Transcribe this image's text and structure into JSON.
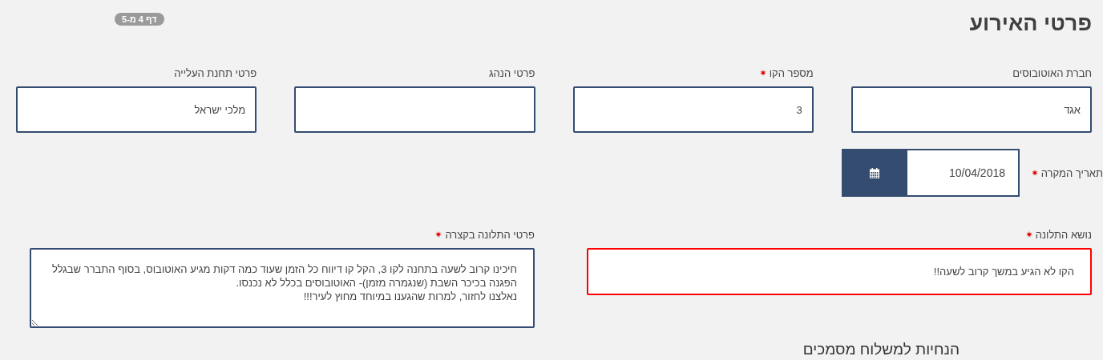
{
  "page_badge": "דף 4 מ-5",
  "title": "פרטי האירוע",
  "fields": [
    {
      "label": "חברת האוטובוסים",
      "value": "אגד",
      "required": false
    },
    {
      "label": "מספר הקו",
      "value": "3",
      "required": true
    },
    {
      "label": "פרטי הנהג",
      "required": false
    },
    {
      "label": "פרטי תחנת העלייה",
      "value": "מלכי ישראל",
      "required": false
    }
  ],
  "date_field": {
    "label": "תאריך המקרה",
    "value": "10/04/2018",
    "required": true
  },
  "complaint_fields": [
    {
      "kind": "input",
      "label": "נושא התלונה",
      "value": "הקו לא הגיע במשך קרוב לשעה!!",
      "required": true,
      "invalid": true
    },
    {
      "kind": "textarea",
      "label": "פרטי התלונה בקצרה",
      "value": "חיכינו קרוב לשעה בתחנה לקו 3, הקל קו דיווח כל הזמן שעוד כמה דקות מגיע האוטובוס, בסוף התברר שבגלל הפגנה בכיכר השבת (שנגמרה מזמן)- האוטובוסים בכלל לא נכנסו.\nנאלצנו לחזור, למרות שהגענו במיוחד מחוץ לעיר!!!",
      "required": true,
      "invalid": false
    }
  ],
  "next_section_title": "הנחיות למשלוח מסמכים"
}
